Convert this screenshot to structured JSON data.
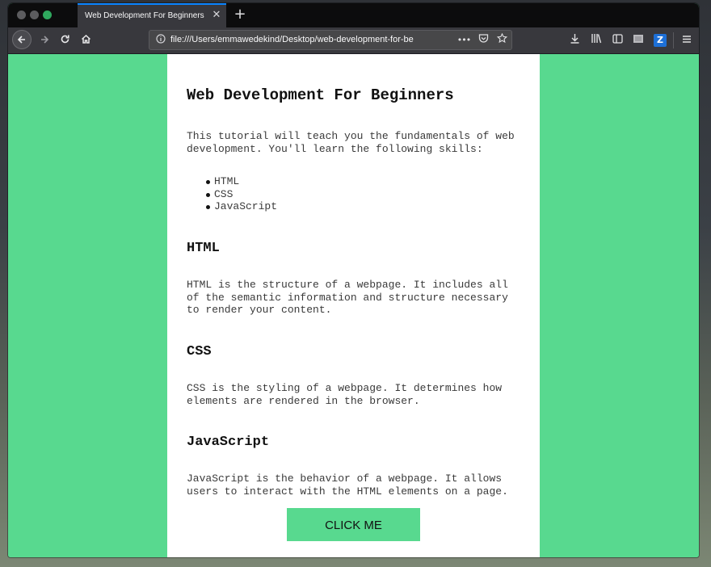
{
  "browser": {
    "tab_title": "Web Development For Beginners",
    "tab_close": "✕",
    "new_tab": "+",
    "url": "file:///Users/emmawedekind/Desktop/web-development-for-be",
    "url_more": "•••",
    "z_badge": "Z"
  },
  "page": {
    "title": "Web Development For Beginners",
    "intro": "This tutorial will teach you the fundamentals of web development. You'll learn the following skills:",
    "skills": [
      "HTML",
      "CSS",
      "JavaScript"
    ],
    "sections": [
      {
        "heading": "HTML",
        "body": "HTML is the structure of a webpage. It includes all of the semantic information and structure necessary to render your content."
      },
      {
        "heading": "CSS",
        "body": "CSS is the styling of a webpage. It determines how elements are rendered in the browser."
      },
      {
        "heading": "JavaScript",
        "body": "JavaScript is the behavior of a webpage. It allows users to interact with the HTML elements on a page."
      }
    ],
    "button_label": "CLICK ME"
  },
  "colors": {
    "page_background": "#58d98f",
    "content_background": "#ffffff",
    "button_background": "#58d98f",
    "tab_accent": "#0a84ff"
  }
}
